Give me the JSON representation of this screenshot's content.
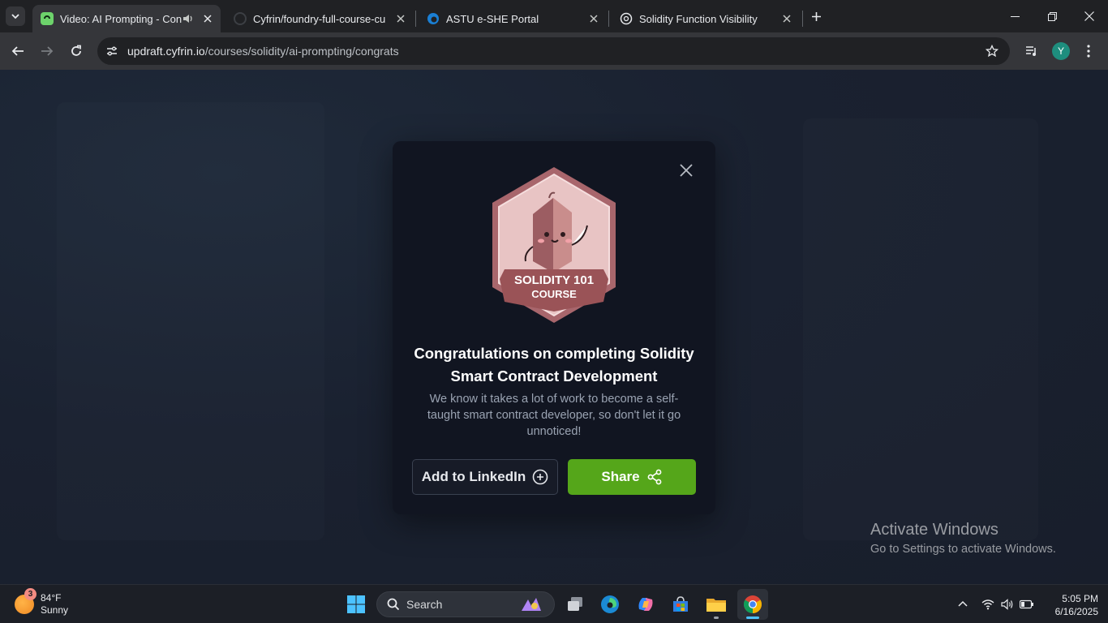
{
  "browser": {
    "tabs": [
      {
        "title": "Video: AI Prompting - Cong",
        "active": true,
        "favicon": "updraft-icon",
        "audio": true
      },
      {
        "title": "Cyfrin/foundry-full-course-cu",
        "active": false,
        "favicon": "github-icon"
      },
      {
        "title": "ASTU e-SHE Portal",
        "active": false,
        "favicon": "edge-icon"
      },
      {
        "title": "Solidity Function Visibility",
        "active": false,
        "favicon": "openai-icon"
      }
    ],
    "url_host": "updraft.cyfrin.io",
    "url_path": "/courses/solidity/ai-prompting/congrats",
    "profile_initial": "Y"
  },
  "modal": {
    "badge": {
      "line1": "SOLIDITY 101",
      "line2": "COURSE"
    },
    "title": "Congratulations on completing Solidity Smart Contract Development",
    "description": "We know it takes a lot of work to become a self-taught smart contract developer, so don't let it go unnoticed!",
    "linkedin_label": "Add to LinkedIn",
    "share_label": "Share",
    "share_color": "#55a61a"
  },
  "watermark": {
    "line1": "Activate Windows",
    "line2": "Go to Settings to activate Windows."
  },
  "taskbar": {
    "weather_temp": "84°F",
    "weather_desc": "Sunny",
    "weather_badge": "3",
    "search_label": "Search",
    "time": "5:05 PM",
    "date": "6/16/2025"
  }
}
